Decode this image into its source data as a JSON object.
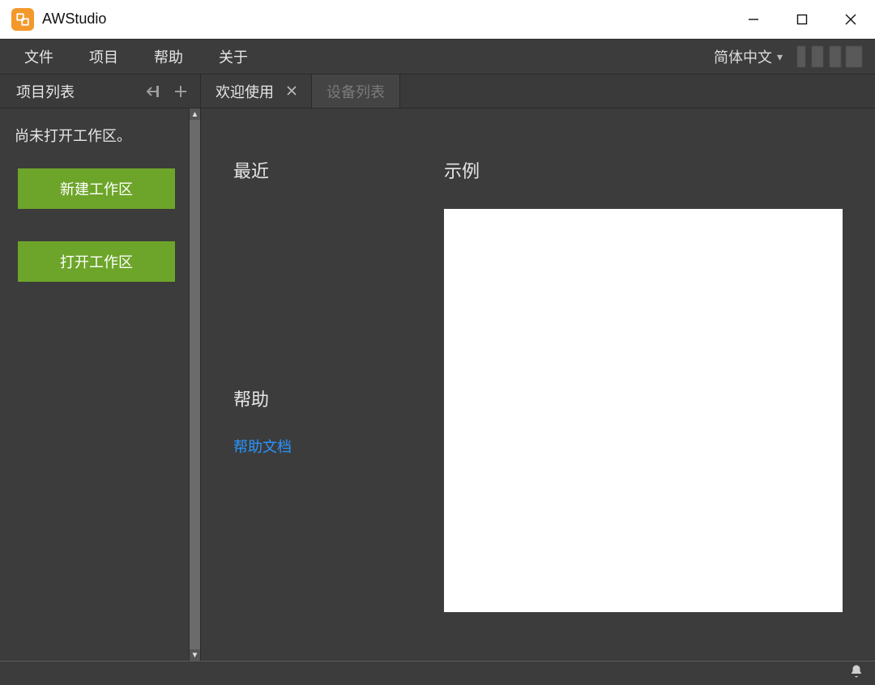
{
  "window": {
    "title": "AWStudio"
  },
  "menus": {
    "file": "文件",
    "project": "项目",
    "help": "帮助",
    "about": "关于"
  },
  "menubar": {
    "language": "简体中文"
  },
  "sidebar": {
    "title": "项目列表",
    "no_workspace_msg": "尚未打开工作区。",
    "new_workspace": "新建工作区",
    "open_workspace": "打开工作区"
  },
  "tabs": {
    "welcome": {
      "label": "欢迎使用"
    },
    "devices": {
      "label": "设备列表"
    }
  },
  "welcome": {
    "recent": "最近",
    "help": "帮助",
    "help_doc": "帮助文档",
    "examples": "示例"
  }
}
